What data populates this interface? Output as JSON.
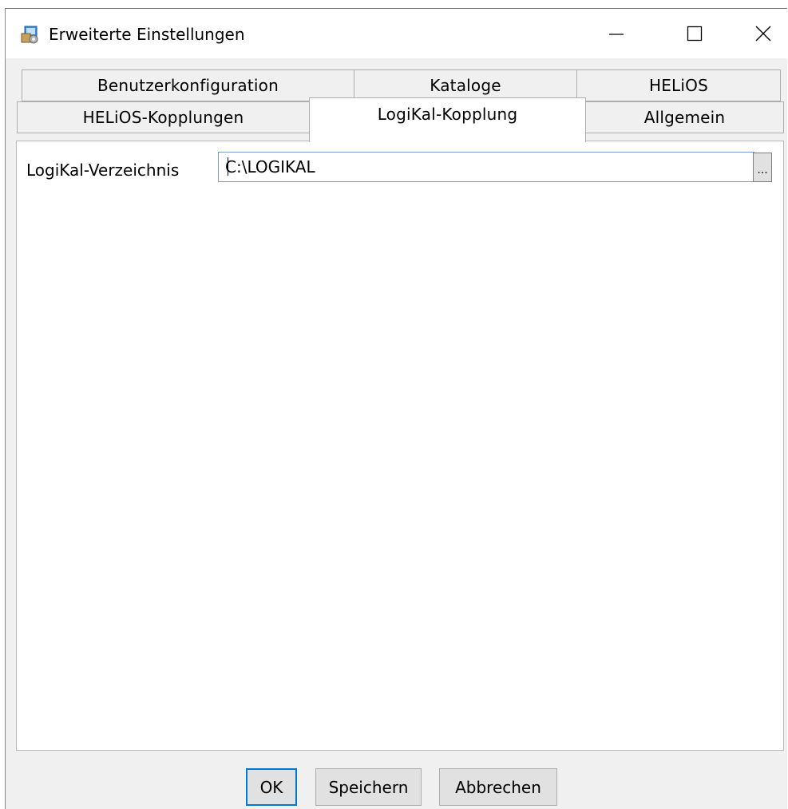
{
  "window": {
    "title": "Erweiterte Einstellungen",
    "icon": "app-settings-icon"
  },
  "titlebar_buttons": {
    "minimize_icon": "minimize-icon",
    "maximize_icon": "maximize-icon",
    "close_icon": "close-icon"
  },
  "tabs": {
    "row_back": [
      {
        "label": "Benutzerkonfiguration"
      },
      {
        "label": "Kataloge"
      },
      {
        "label": "HELiOS"
      }
    ],
    "row_front": [
      {
        "label": "HELiOS-Kopplungen"
      },
      {
        "label": "LogiKal-Kopplung"
      },
      {
        "label": "Allgemein"
      }
    ],
    "active": "LogiKal-Kopplung"
  },
  "panel": {
    "field_label": "LogiKal-Verzeichnis",
    "path_value": "C:\\LOGIKAL",
    "browse_label": "..."
  },
  "buttons": {
    "ok": "OK",
    "save": "Speichern",
    "cancel": "Abbrechen"
  },
  "colors": {
    "focus_border": "#0078d7",
    "input_border": "#7a9cc7"
  }
}
